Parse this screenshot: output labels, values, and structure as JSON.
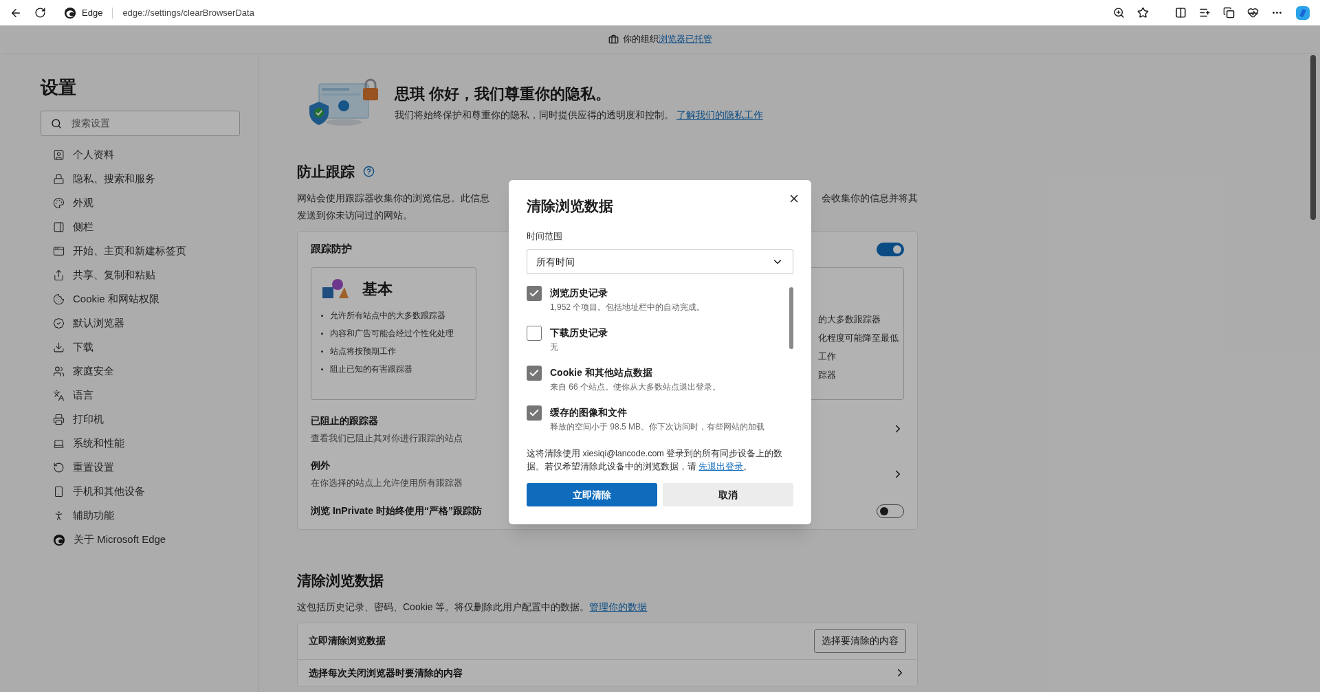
{
  "toolbar": {
    "browser_label": "Edge",
    "address": "edge://settings/clearBrowserData"
  },
  "banner": {
    "text": "你的组织",
    "link": "浏览器已托管"
  },
  "sidebar": {
    "title": "设置",
    "search": {
      "placeholder": "搜索设置"
    },
    "items": [
      {
        "label": "个人资料"
      },
      {
        "label": "隐私、搜索和服务"
      },
      {
        "label": "外观"
      },
      {
        "label": "侧栏"
      },
      {
        "label": "开始、主页和新建标签页"
      },
      {
        "label": "共享、复制和粘贴"
      },
      {
        "label": "Cookie 和网站权限"
      },
      {
        "label": "默认浏览器"
      },
      {
        "label": "下载"
      },
      {
        "label": "家庭安全"
      },
      {
        "label": "语言"
      },
      {
        "label": "打印机"
      },
      {
        "label": "系统和性能"
      },
      {
        "label": "重置设置"
      },
      {
        "label": "手机和其他设备"
      },
      {
        "label": "辅助功能"
      },
      {
        "label": "关于 Microsoft Edge"
      }
    ]
  },
  "privacy_header": {
    "title": "思琪 你好，我们尊重你的隐私。",
    "text": "我们将始终保护和尊重你的隐私，同时提供应得的透明度和控制。",
    "link": "了解我们的隐私工作"
  },
  "tracking": {
    "title": "防止跟踪",
    "description_left": "网站会使用跟踪器收集你的浏览信息。此信息",
    "description_right": "会收集你的信息并将其",
    "description_line2": "发送到你未访问过的网站。",
    "protection": {
      "label": "跟踪防护",
      "on": true
    },
    "levels": [
      {
        "title": "基本",
        "bullets": [
          "允许所有站点中的大多数跟踪器",
          "内容和广告可能会经过个性化处理",
          "站点将按预期工作",
          "阻止已知的有害跟踪器"
        ]
      },
      {
        "bullets": [
          "的大多数跟踪器",
          "化程度可能降至最低",
          "工作",
          "踪器"
        ]
      }
    ],
    "rows": [
      {
        "kind": "link",
        "title": "已阻止的跟踪器",
        "subtitle": "查看我们已阻止其对你进行跟踪的站点"
      },
      {
        "kind": "link",
        "title": "例外",
        "subtitle": "在你选择的站点上允许使用所有跟踪器"
      },
      {
        "kind": "toggle",
        "title": "浏览 InPrivate 时始终使用“严格”跟踪防",
        "on": false
      }
    ]
  },
  "clear_data": {
    "title": "清除浏览数据",
    "text": "这包括历史记录、密码、Cookie 等。将仅删除此用户配置中的数据。",
    "link": "管理你的数据",
    "rows": [
      {
        "kind": "button",
        "label": "立即清除浏览数据",
        "button": "选择要清除的内容"
      },
      {
        "kind": "link",
        "label": "选择每次关闭浏览器时要清除的内容"
      }
    ]
  },
  "dialog": {
    "title": "清除浏览数据",
    "range_label": "时间范围",
    "range_value": "所有时间",
    "items": [
      {
        "label": "浏览历史记录",
        "detail": "1,952 个项目。包括地址栏中的自动完成。",
        "checked": true
      },
      {
        "label": "下载历史记录",
        "detail": "无",
        "checked": false
      },
      {
        "label": "Cookie 和其他站点数据",
        "detail": "来自 66 个站点。使你从大多数站点退出登录。",
        "checked": true
      },
      {
        "label": "缓存的图像和文件",
        "detail": "释放的空间小于 98.5 MB。你下次访问时，有些网站的加载",
        "checked": true
      }
    ],
    "notice": "这将清除使用 xiesiqi@lancode.com 登录到的所有同步设备上的数据。若仅希望清除此设备中的浏览数据，请 ",
    "notice_link": "先退出登录",
    "notice_end": "。",
    "buttons": [
      {
        "kind": "primary",
        "label": "立即清除"
      },
      {
        "kind": "secondary",
        "label": "取消"
      }
    ]
  }
}
